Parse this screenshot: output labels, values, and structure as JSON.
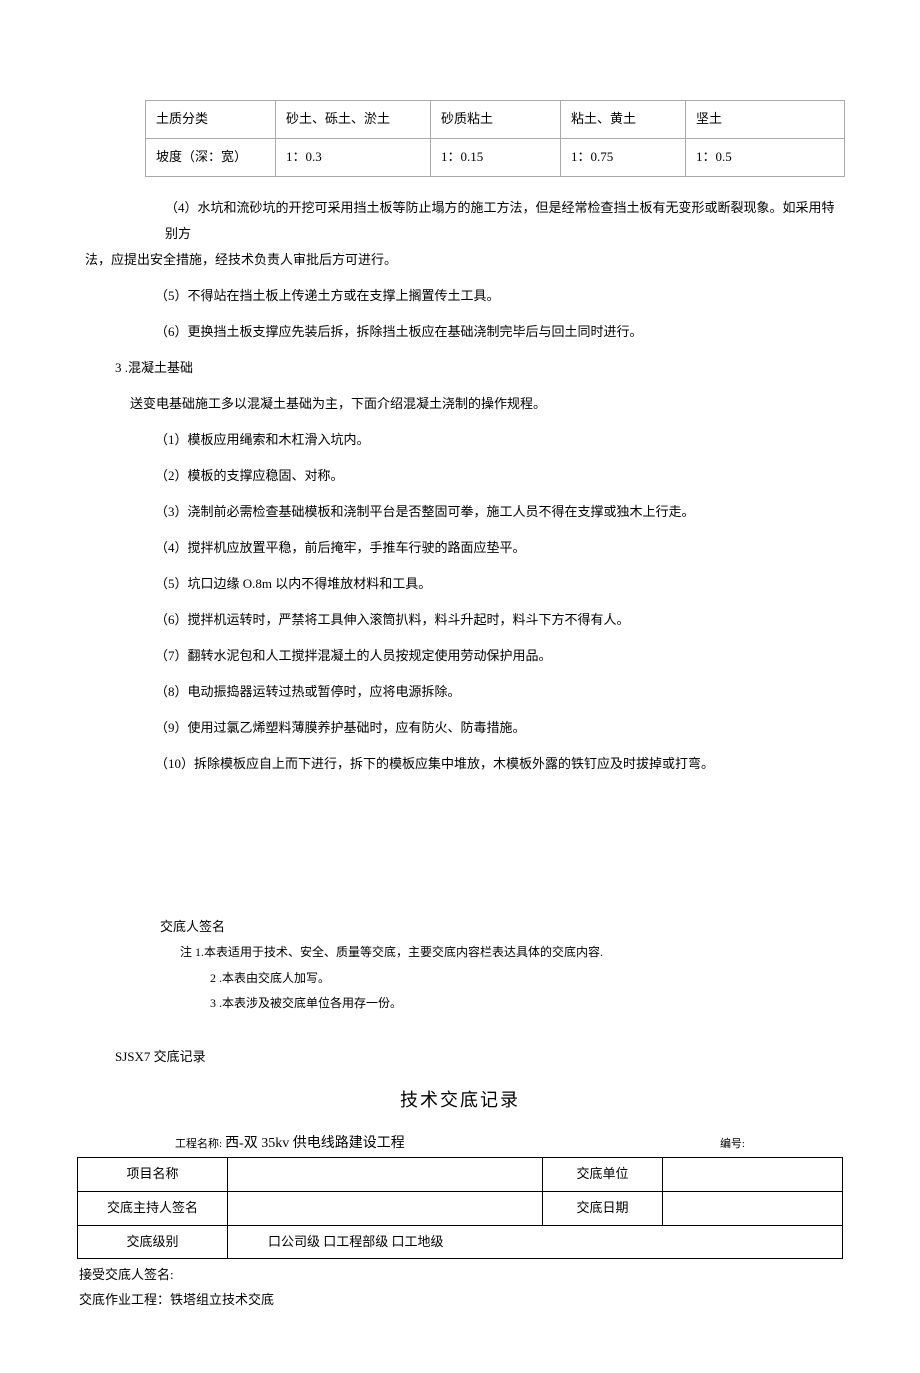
{
  "soil_table": {
    "rows": [
      {
        "label": "土质分类",
        "c1": "砂土、砾土、淤土",
        "c2": "砂质粘土",
        "c3": "粘土、黄土",
        "c4": "坚土"
      },
      {
        "label": "坡度（深：宽）",
        "c1": "1：0.3",
        "c2": "1：0.15",
        "c3": "1：0.75",
        "c4": "1：0.5"
      }
    ]
  },
  "body": {
    "p4a": "（4）水坑和流砂坑的开挖可采用挡土板等防止塌方的施工方法，但是经常检查挡土板有无变形或断裂现象。如采用特别方",
    "p4b": "法，应提出安全措施，经技术负责人审批后方可进行。",
    "p5": "（5）不得站在挡土板上传递土方或在支撑上搁置传土工具。",
    "p6": "（6）更换挡土板支撑应先装后拆，拆除挡土板应在基础浇制完毕后与回土同时进行。",
    "s3": "3  .混凝土基础",
    "s3_intro": "送变电基础施工多以混凝土基础为主，下面介绍混凝土浇制的操作规程。",
    "c1": "（1）模板应用绳索和木杠滑入坑内。",
    "c2": "（2）模板的支撑应稳固、对称。",
    "c3": "（3）浇制前必需检查基础模板和浇制平台是否整固可拳，施工人员不得在支撑或独木上行走。",
    "c4": "（4）搅拌机应放置平稳，前后掩牢，手推车行驶的路面应垫平。",
    "c5": "（5）坑口边缘 O.8m 以内不得堆放材料和工具。",
    "c6": "（6）搅拌机运转时，严禁将工具伸入滚筒扒料，料斗升起时，料斗下方不得有人。",
    "c7": "（7）翻转水泥包和人工搅拌混凝土的人员按规定使用劳动保护用品。",
    "c8": "（8）电动振捣器运转过热或暂停时，应将电源拆除。",
    "c9": "（9）使用过氯乙烯塑料薄膜养护基础时，应有防火、防毒措施。",
    "c10": "（10）拆除模板应自上而下进行，拆下的模板应集中堆放，木模板外露的铁钉应及时拔掉或打弯。"
  },
  "signature_label": "交底人签名",
  "notes": {
    "n1": "注 1.本表适用于技术、安全、质量等交底，主要交底内容栏表达具体的交底内容.",
    "n2": "2   .本表由交底人加写。",
    "n3": "3   .本表涉及被交底单位各用存一份。"
  },
  "record_code": "SJSX7 交底记录",
  "title2": "技术交底记录",
  "project": {
    "label": "工程名称:",
    "name": "西-双 35kv 供电线路建设工程",
    "number_label": "编号:"
  },
  "form": {
    "r1c1": "项目名称",
    "r1c3": "交底单位",
    "r2c1": "交底主持人签名",
    "r2c3": "交底日期",
    "r3c1": "交底级别",
    "r3c2": "口公司级        口工程部级           口工地级"
  },
  "below": {
    "l1": "接受交底人签名:",
    "l2": "交底作业工程：铁塔组立技术交底"
  }
}
